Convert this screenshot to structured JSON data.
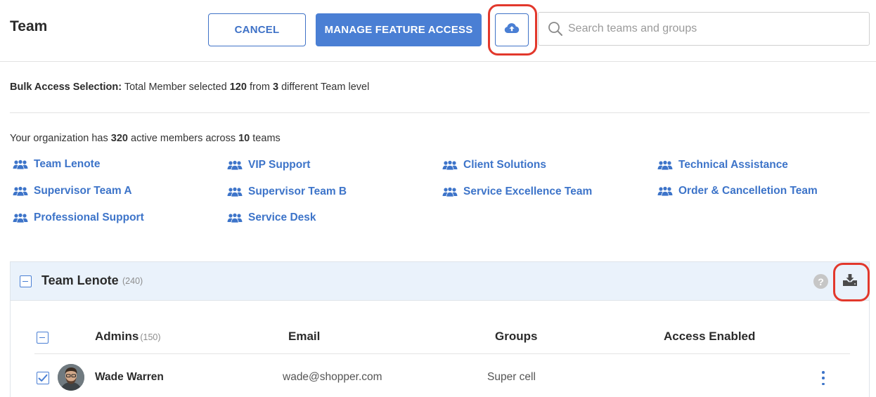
{
  "header": {
    "title": "Team",
    "cancel_label": "CANCEL",
    "manage_label": "MANAGE FEATURE ACCESS",
    "upload_icon": "cloud-upload-icon",
    "search_placeholder": "Search teams and groups",
    "search_value": ""
  },
  "bulk": {
    "label": "Bulk Access Selection:",
    "text_before": "Total Member selected",
    "members_selected": "120",
    "text_mid": "from",
    "team_levels": "3",
    "text_after": "different Team level"
  },
  "org": {
    "text_before": "Your organization has",
    "active_members": "320",
    "text_mid": "active members across",
    "teams_count": "10",
    "text_after": "teams"
  },
  "teams": [
    "Team Lenote",
    "VIP Support",
    "Client Solutions",
    "Technical Assistance",
    "Supervisor Team A",
    "Supervisor Team B",
    "Service Excellence Team",
    "Order & Cancelletion Team",
    "Professional Support",
    "Service Desk"
  ],
  "panel": {
    "title": "Team Lenote",
    "count": "(240)",
    "help_label": "?",
    "columns": {
      "admins": "Admins",
      "admins_count": "(150)",
      "email": "Email",
      "groups": "Groups",
      "access": "Access Enabled"
    },
    "rows": [
      {
        "checked": true,
        "name": "Wade Warren",
        "email": "wade@shopper.com",
        "group": "Super cell",
        "access": ""
      }
    ]
  },
  "colors": {
    "accent": "#4a7fd4",
    "link": "#3d74c9",
    "highlight": "#e2382c",
    "panel_header_bg": "#eaf2fb"
  }
}
